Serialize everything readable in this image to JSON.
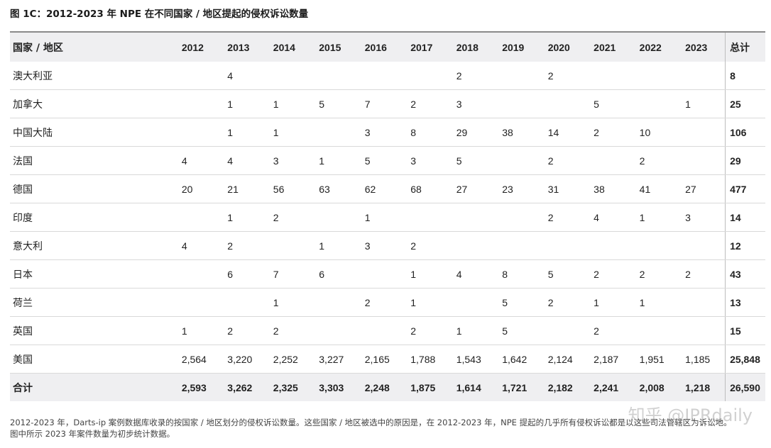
{
  "title": "图 1C：2012-2023 年 NPE 在不同国家 / 地区提起的侵权诉讼数量",
  "header": {
    "region_label": "国家 / 地区",
    "years": [
      "2012",
      "2013",
      "2014",
      "2015",
      "2016",
      "2017",
      "2018",
      "2019",
      "2020",
      "2021",
      "2022",
      "2023"
    ],
    "total_label": "总计"
  },
  "rows": [
    {
      "name": "澳大利亚",
      "values": [
        "",
        "4",
        "",
        "",
        "",
        "",
        "2",
        "",
        "2",
        "",
        "",
        ""
      ],
      "total": "8"
    },
    {
      "name": "加拿大",
      "values": [
        "",
        "1",
        "1",
        "5",
        "7",
        "2",
        "3",
        "",
        "",
        "5",
        "",
        "1"
      ],
      "total": "25"
    },
    {
      "name": "中国大陆",
      "values": [
        "",
        "1",
        "1",
        "",
        "3",
        "8",
        "29",
        "38",
        "14",
        "2",
        "10",
        ""
      ],
      "total": "106"
    },
    {
      "name": "法国",
      "values": [
        "4",
        "4",
        "3",
        "1",
        "5",
        "3",
        "5",
        "",
        "2",
        "",
        "2",
        ""
      ],
      "total": "29"
    },
    {
      "name": "德国",
      "values": [
        "20",
        "21",
        "56",
        "63",
        "62",
        "68",
        "27",
        "23",
        "31",
        "38",
        "41",
        "27"
      ],
      "total": "477"
    },
    {
      "name": "印度",
      "values": [
        "",
        "1",
        "2",
        "",
        "1",
        "",
        "",
        "",
        "2",
        "4",
        "1",
        "3"
      ],
      "total": "14"
    },
    {
      "name": "意大利",
      "values": [
        "4",
        "2",
        "",
        "1",
        "3",
        "2",
        "",
        "",
        "",
        "",
        "",
        ""
      ],
      "total": "12"
    },
    {
      "name": "日本",
      "values": [
        "",
        "6",
        "7",
        "6",
        "",
        "1",
        "4",
        "8",
        "5",
        "2",
        "2",
        "2"
      ],
      "total": "43"
    },
    {
      "name": "荷兰",
      "values": [
        "",
        "",
        "1",
        "",
        "2",
        "1",
        "",
        "5",
        "2",
        "1",
        "1",
        ""
      ],
      "total": "13"
    },
    {
      "name": "英国",
      "values": [
        "1",
        "2",
        "2",
        "",
        "",
        "2",
        "1",
        "5",
        "",
        "2",
        "",
        ""
      ],
      "total": "15"
    },
    {
      "name": "美国",
      "values": [
        "2,564",
        "3,220",
        "2,252",
        "3,227",
        "2,165",
        "1,788",
        "1,543",
        "1,642",
        "2,124",
        "2,187",
        "1,951",
        "1,185"
      ],
      "total": "25,848"
    }
  ],
  "sum_row": {
    "name": "合计",
    "values": [
      "2,593",
      "3,262",
      "2,325",
      "3,303",
      "2,248",
      "1,875",
      "1,614",
      "1,721",
      "2,182",
      "2,241",
      "2,008",
      "1,218"
    ],
    "total": "26,590"
  },
  "note_line1": "2012-2023 年，Darts-ip 案例数据库收录的按国家 / 地区划分的侵权诉讼数量。这些国家 / 地区被选中的原因是，在 2012-2023 年，NPE 提起的几乎所有侵权诉讼都是以这些司法管辖区为诉讼地。",
  "note_line2": "图中所示 2023 年案件数量为初步统计数据。",
  "watermark": "知乎 @IPRdaily"
}
